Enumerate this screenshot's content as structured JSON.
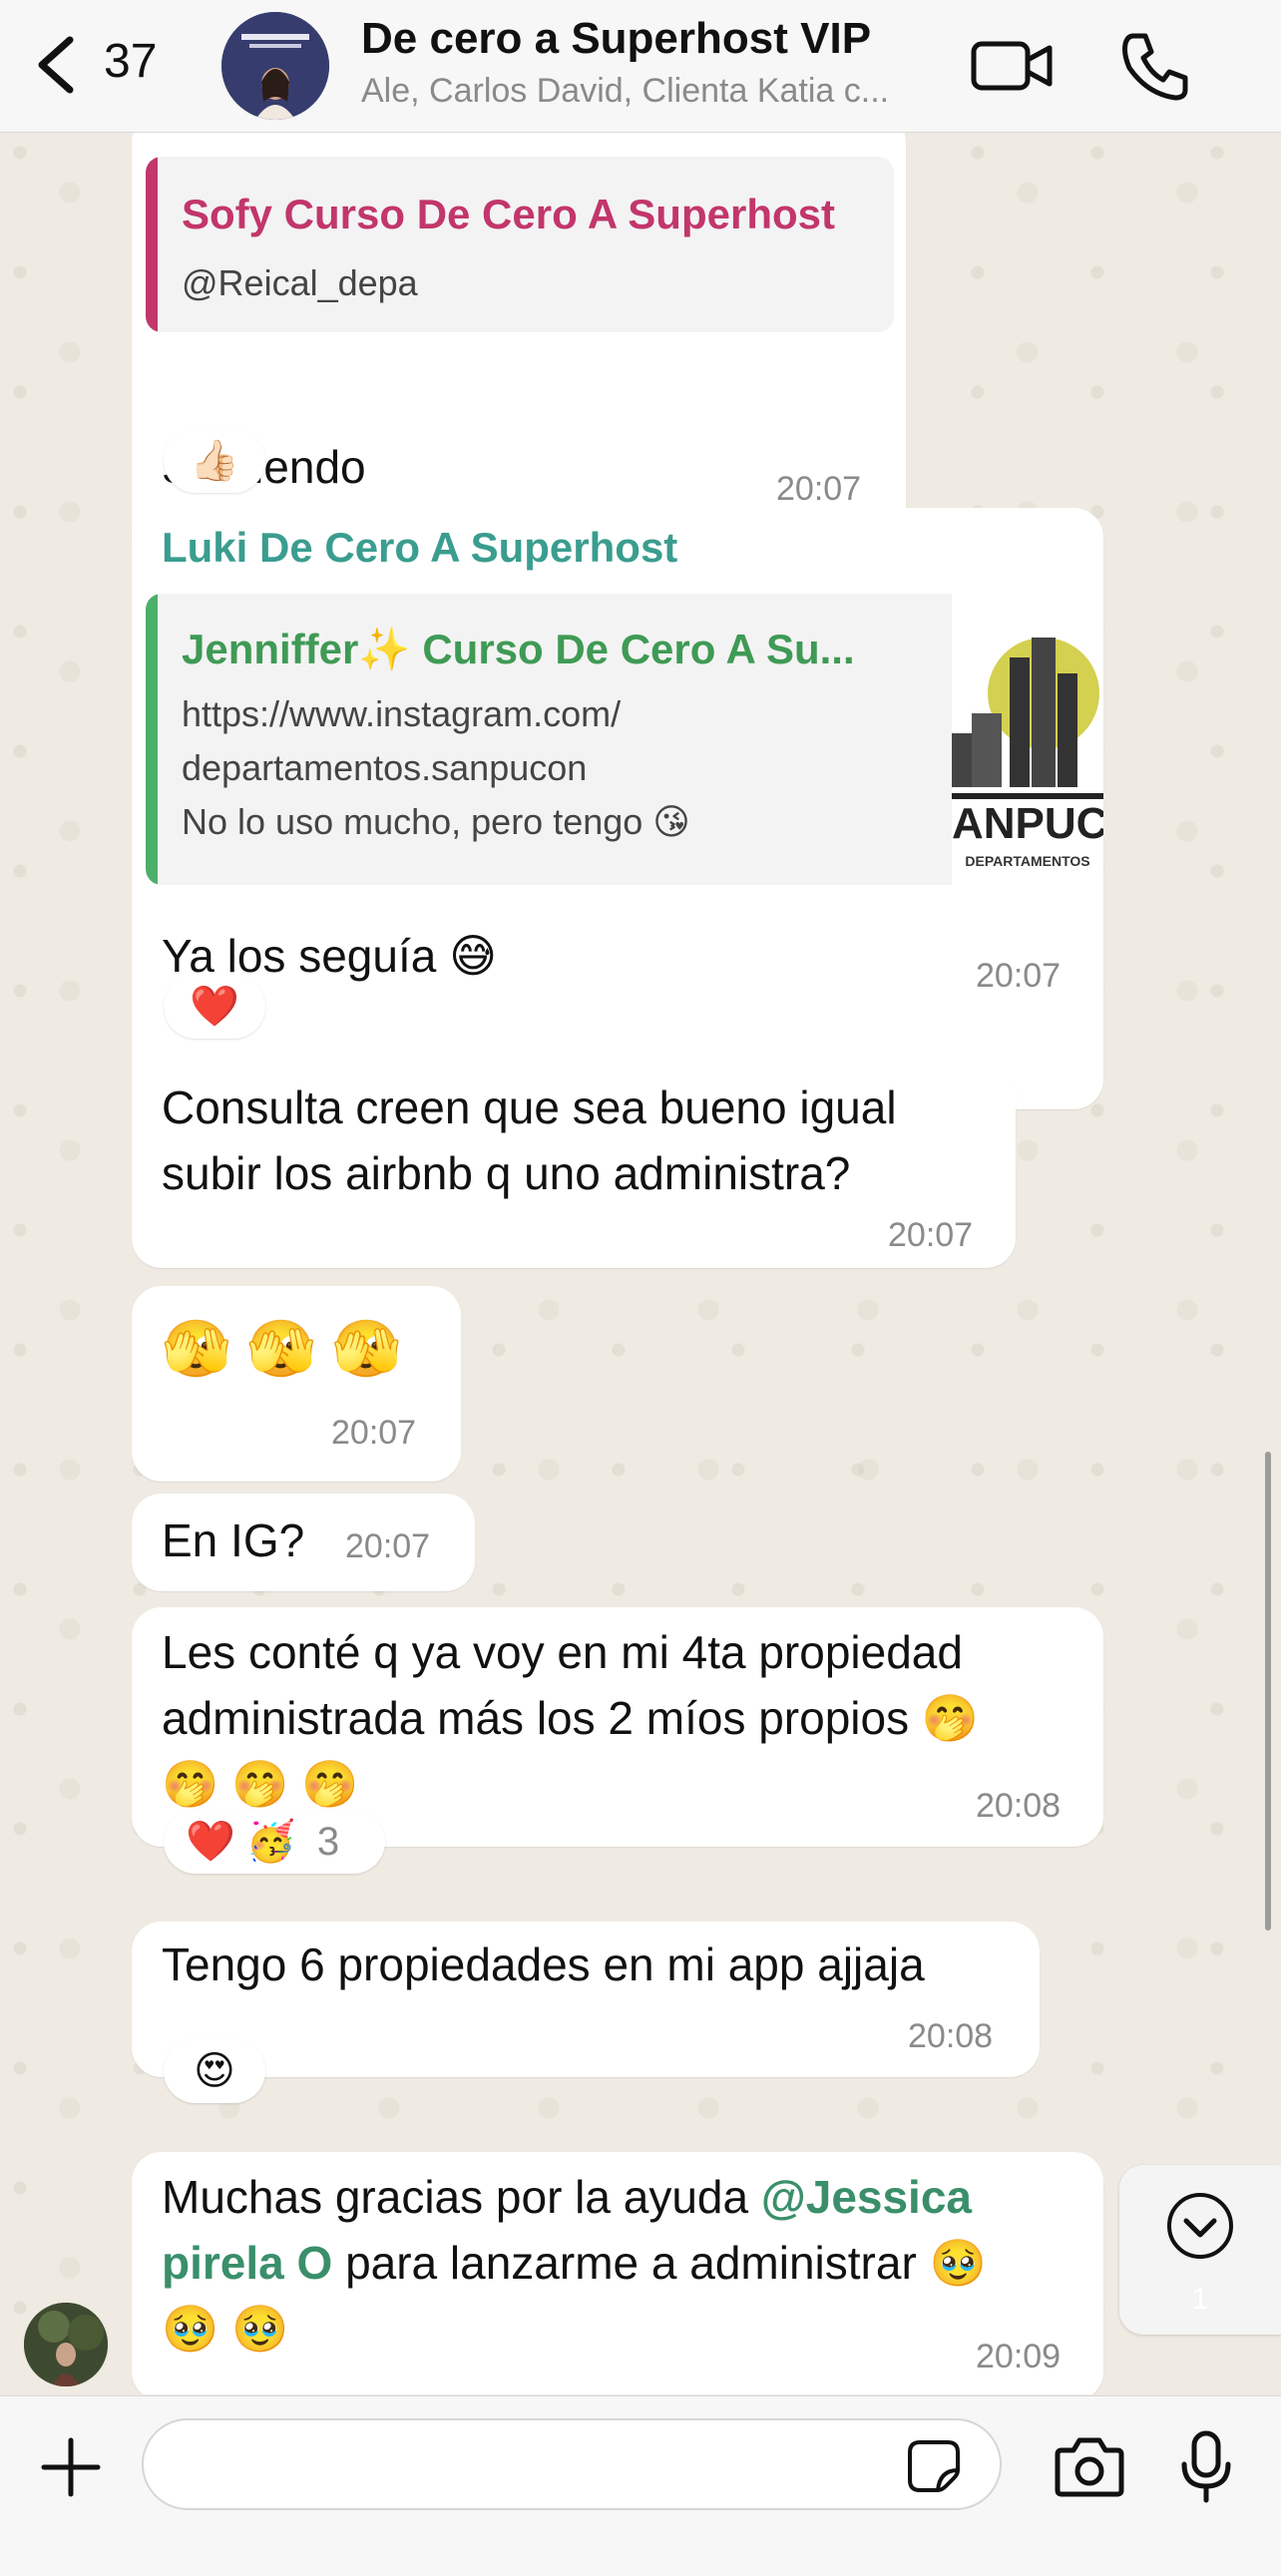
{
  "header": {
    "back_count": "37",
    "title": "De cero a Superhost VIP",
    "members": "Ale, Carlos David, Clienta Katia c..."
  },
  "messages": [
    {
      "quote_title": "Sofy Curso De Cero A Superhost",
      "quote_text": "@Reical_depa",
      "text": "Siguiendo",
      "time": "20:07",
      "reaction": "👍🏻"
    },
    {
      "sender": "Luki De Cero A Superhost",
      "quote_title": "Jenniffer✨ Curso De Cero A Su...",
      "quote_line1": "https://www.instagram.com/",
      "quote_line2": "departamentos.sanpucon",
      "quote_line3": "No lo uso mucho, pero tengo 😘",
      "thumb_text": "ANPUCO",
      "thumb_sub": "DEPARTAMENTOS",
      "text": "Ya los seguía 😅",
      "time": "20:07",
      "reaction": "❤️"
    },
    {
      "line1": "Consulta creen que sea bueno igual",
      "line2": "subir los airbnb q uno administra?",
      "time": "20:07"
    },
    {
      "text": "🫣 🫣 🫣",
      "time": "20:07"
    },
    {
      "text": "En IG?",
      "time": "20:07"
    },
    {
      "line1": "Les conté q ya voy en mi 4ta propiedad",
      "line2": "administrada más los 2 míos propios 🤭",
      "line3": "🤭 🤭 🤭",
      "time": "20:08",
      "reaction_emojis": "❤️ 🥳",
      "reaction_count": "3"
    },
    {
      "text": "Tengo 6 propiedades en mi app ajjaja",
      "time": "20:08",
      "reaction": "😍"
    },
    {
      "line1_a": "Muchas gracias por la ayuda ",
      "mention_line1": "@Jessica",
      "mention_line2": "pirela O",
      "line2_b": " para lanzarme a administrar 🥹",
      "line3": "🥹 🥹",
      "time": "20:09"
    }
  ],
  "scroll_button": {
    "count": "1"
  },
  "input": {
    "placeholder": ""
  },
  "colors": {
    "quote1_bar": "#c2366b",
    "quote1_title": "#c2366b",
    "quote2_bar": "#4caf6a",
    "quote2_title": "#3f9a55",
    "sender": "#3a9d8f",
    "mention": "#3a8f6a"
  }
}
